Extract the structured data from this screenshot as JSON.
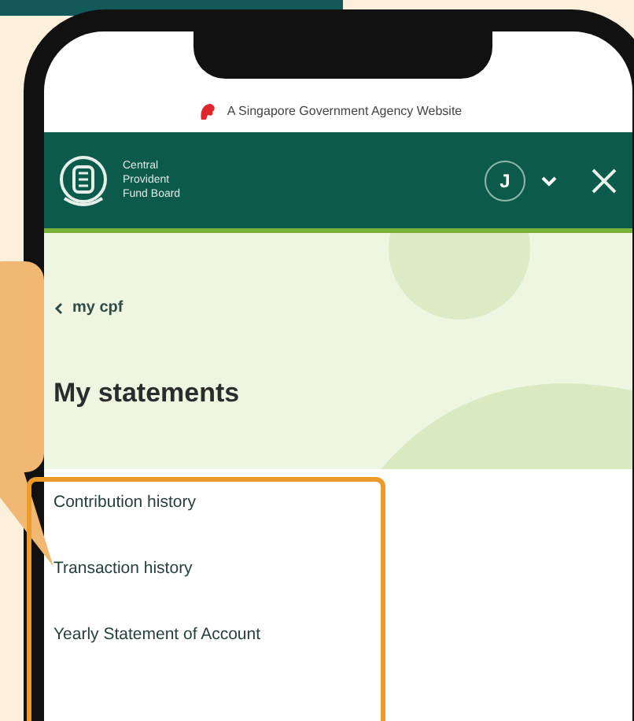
{
  "gov_banner": {
    "text": "A Singapore Government Agency Website"
  },
  "header": {
    "org_name": [
      "Central",
      "Provident",
      "Fund Board"
    ],
    "avatar_initial": "J"
  },
  "back_link": {
    "label": "my cpf"
  },
  "page_title": "My statements",
  "menu_items": [
    {
      "label": "Contribution history"
    },
    {
      "label": "Transaction history"
    },
    {
      "label": "Yearly Statement of Account"
    }
  ]
}
